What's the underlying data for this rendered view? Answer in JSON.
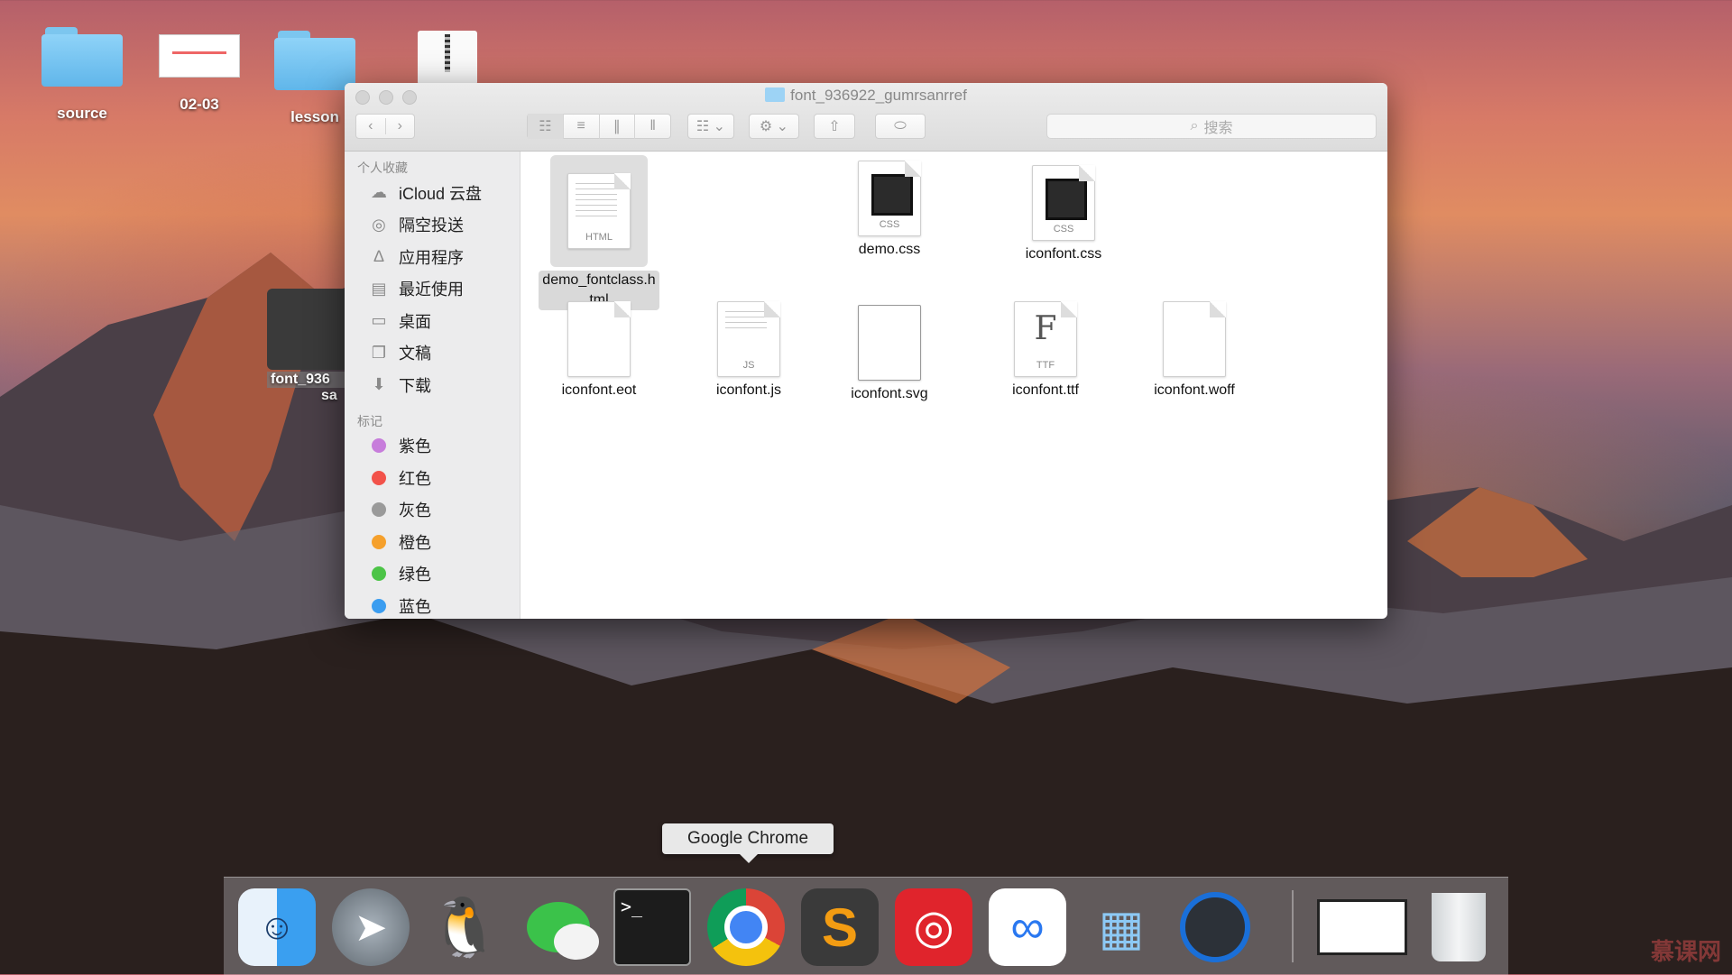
{
  "desktop": {
    "items": [
      {
        "label": "source"
      },
      {
        "label": "02-03"
      },
      {
        "label": "lesson"
      },
      {
        "label": ""
      }
    ],
    "partial_item": {
      "line1": "font_936",
      "line2": "sa"
    }
  },
  "finder": {
    "title": "font_936922_gumrsanrref",
    "search_placeholder": "搜索",
    "sidebar": {
      "favorites_header": "个人收藏",
      "favorites": [
        {
          "label": "iCloud 云盘",
          "icon": "cloud-icon"
        },
        {
          "label": "隔空投送",
          "icon": "airdrop-icon"
        },
        {
          "label": "应用程序",
          "icon": "applications-icon"
        },
        {
          "label": "最近使用",
          "icon": "recents-icon"
        },
        {
          "label": "桌面",
          "icon": "desktop-icon"
        },
        {
          "label": "文稿",
          "icon": "documents-icon"
        },
        {
          "label": "下载",
          "icon": "downloads-icon"
        }
      ],
      "tags_header": "标记",
      "tags": [
        {
          "label": "紫色",
          "color": "#c77ddb"
        },
        {
          "label": "红色",
          "color": "#f2524a"
        },
        {
          "label": "灰色",
          "color": "#9a9a9a"
        },
        {
          "label": "橙色",
          "color": "#f5a02c"
        },
        {
          "label": "绿色",
          "color": "#4cc447"
        },
        {
          "label": "蓝色",
          "color": "#3b9df0"
        }
      ]
    },
    "files": [
      {
        "name": "demo_fontclass.h\ntml",
        "ext": "HTML",
        "kind": "html",
        "selected": true
      },
      {
        "name": "demo.css",
        "ext": "CSS",
        "kind": "css",
        "selected": false
      },
      {
        "name": "iconfont.css",
        "ext": "CSS",
        "kind": "css",
        "selected": false
      },
      {
        "name": "iconfont.eot",
        "ext": "",
        "kind": "blank",
        "selected": false
      },
      {
        "name": "iconfont.js",
        "ext": "JS",
        "kind": "js",
        "selected": false
      },
      {
        "name": "iconfont.svg",
        "ext": "",
        "kind": "svg",
        "selected": false
      },
      {
        "name": "iconfont.ttf",
        "ext": "TTF",
        "kind": "ttf",
        "selected": false
      },
      {
        "name": "iconfont.woff",
        "ext": "",
        "kind": "blank",
        "selected": false
      }
    ]
  },
  "tooltip": {
    "text": "Google Chrome"
  },
  "dock": {
    "apps": [
      "finder-icon",
      "launchpad-icon",
      "qq-icon",
      "wechat-icon",
      "terminal-icon",
      "chrome-icon",
      "sublime-text-icon",
      "netease-music-icon",
      "baidu-netdisk-icon",
      "keynote-icon",
      "quicktime-icon",
      "preview-window-icon",
      "trash-icon"
    ]
  },
  "watermark": "慕课网"
}
